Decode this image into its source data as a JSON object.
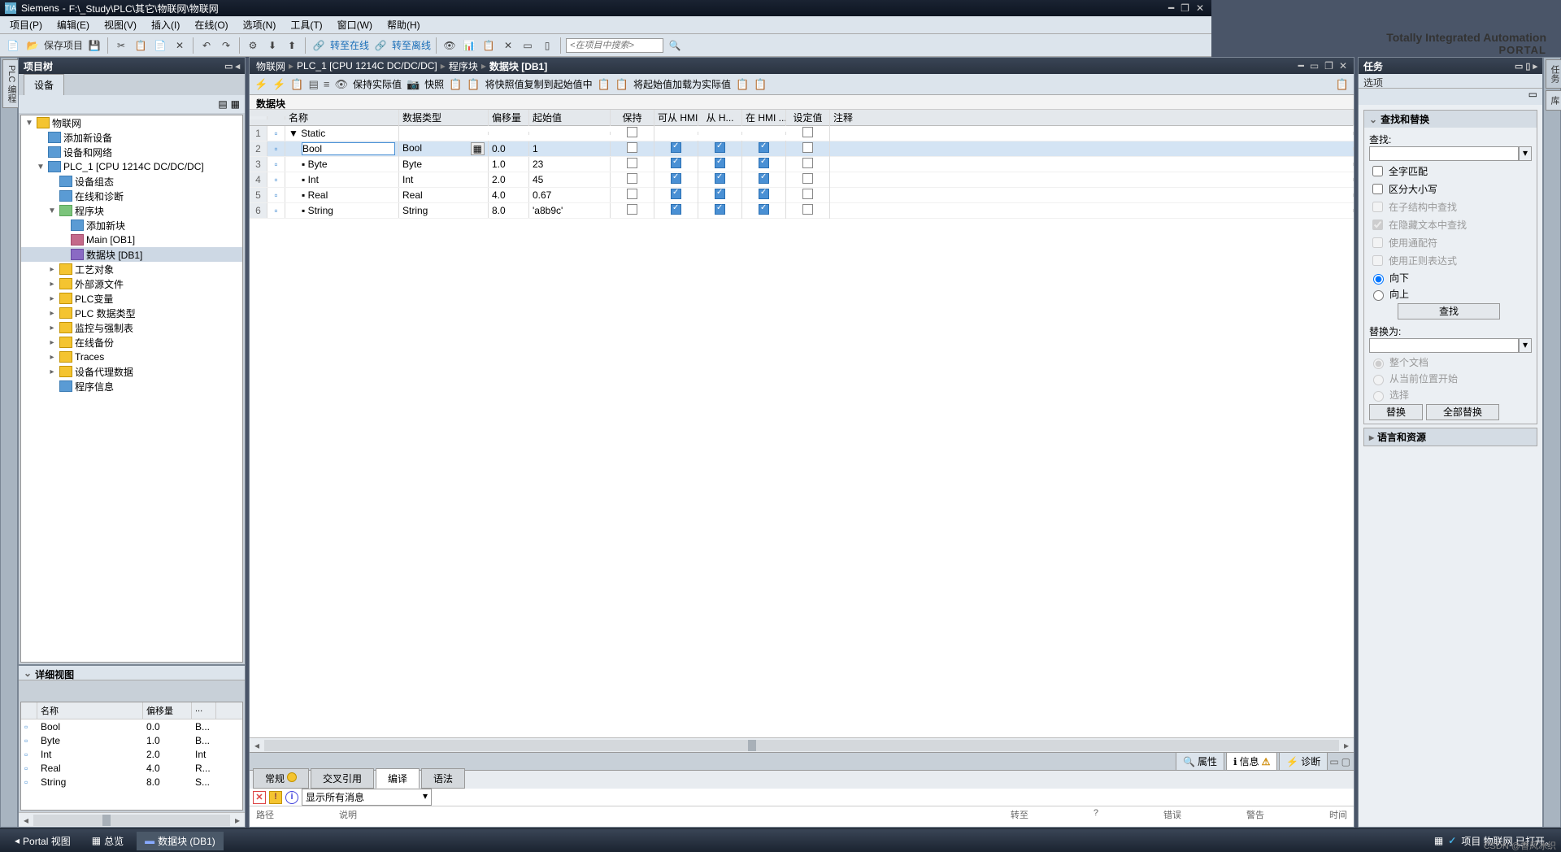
{
  "title": {
    "app": "Siemens",
    "path": "F:\\_Study\\PLC\\其它\\物联网\\物联网"
  },
  "menu": [
    "项目(P)",
    "编辑(E)",
    "视图(V)",
    "插入(I)",
    "在线(O)",
    "选项(N)",
    "工具(T)",
    "窗口(W)",
    "帮助(H)"
  ],
  "brand": {
    "t1": "Totally Integrated Automation",
    "t2": "PORTAL"
  },
  "toolbar": {
    "save": "保存项目",
    "goonline": "转至在线",
    "gooffline": "转至离线",
    "search_ph": "<在项目中搜索>"
  },
  "left_panel": {
    "title": "项目树",
    "tab": "设备"
  },
  "tree": [
    {
      "d": 0,
      "exp": "▼",
      "ic": "ic-folder",
      "t": "物联网"
    },
    {
      "d": 1,
      "exp": "",
      "ic": "ic-device",
      "t": "添加新设备"
    },
    {
      "d": 1,
      "exp": "",
      "ic": "ic-device",
      "t": "设备和网络"
    },
    {
      "d": 1,
      "exp": "▼",
      "ic": "ic-device",
      "t": "PLC_1 [CPU 1214C DC/DC/DC]"
    },
    {
      "d": 2,
      "exp": "",
      "ic": "ic-device",
      "t": "设备组态"
    },
    {
      "d": 2,
      "exp": "",
      "ic": "ic-device",
      "t": "在线和诊断"
    },
    {
      "d": 2,
      "exp": "▼",
      "ic": "ic-prog",
      "t": "程序块"
    },
    {
      "d": 3,
      "exp": "",
      "ic": "ic-device",
      "t": "添加新块"
    },
    {
      "d": 3,
      "exp": "",
      "ic": "ic-main",
      "t": "Main [OB1]"
    },
    {
      "d": 3,
      "exp": "",
      "ic": "ic-db",
      "t": "数据块 [DB1]",
      "sel": true
    },
    {
      "d": 2,
      "exp": "▸",
      "ic": "ic-folder",
      "t": "工艺对象"
    },
    {
      "d": 2,
      "exp": "▸",
      "ic": "ic-folder",
      "t": "外部源文件"
    },
    {
      "d": 2,
      "exp": "▸",
      "ic": "ic-folder",
      "t": "PLC变量"
    },
    {
      "d": 2,
      "exp": "▸",
      "ic": "ic-folder",
      "t": "PLC 数据类型"
    },
    {
      "d": 2,
      "exp": "▸",
      "ic": "ic-folder",
      "t": "监控与强制表"
    },
    {
      "d": 2,
      "exp": "▸",
      "ic": "ic-folder",
      "t": "在线备份"
    },
    {
      "d": 2,
      "exp": "▸",
      "ic": "ic-folder",
      "t": "Traces"
    },
    {
      "d": 2,
      "exp": "▸",
      "ic": "ic-folder",
      "t": "设备代理数据"
    },
    {
      "d": 2,
      "exp": "",
      "ic": "ic-device",
      "t": "程序信息"
    }
  ],
  "detail": {
    "title": "详细视图",
    "cols": [
      "名称",
      "偏移量",
      "..."
    ],
    "rows": [
      {
        "n": "Bool",
        "o": "0.0",
        "t": "B..."
      },
      {
        "n": "Byte",
        "o": "1.0",
        "t": "B..."
      },
      {
        "n": "Int",
        "o": "2.0",
        "t": "Int"
      },
      {
        "n": "Real",
        "o": "4.0",
        "t": "R..."
      },
      {
        "n": "String",
        "o": "8.0",
        "t": "S..."
      }
    ]
  },
  "crumb": [
    "物联网",
    "PLC_1 [CPU 1214C DC/DC/DC]",
    "程序块",
    "数据块 [DB1]"
  ],
  "ctoolbar": {
    "keep": "保持实际值",
    "snap": "快照",
    "copy_snap": "将快照值复制到起始值中",
    "load_init": "将起始值加载为实际值"
  },
  "ctitle": "数据块",
  "grid": {
    "cols": [
      "",
      "",
      "名称",
      "数据类型",
      "偏移量",
      "起始值",
      "保持",
      "可从 HMI/...",
      "从 H...",
      "在 HMI ...",
      "设定值",
      "注释"
    ],
    "rows": [
      {
        "n": 1,
        "name": "Static",
        "type": "",
        "off": "",
        "init": "",
        "hdr": true
      },
      {
        "n": 2,
        "name": "Bool",
        "type": "Bool",
        "off": "0.0",
        "init": "1",
        "chk": [
          false,
          true,
          true,
          true,
          false
        ],
        "sel": true
      },
      {
        "n": 3,
        "name": "Byte",
        "type": "Byte",
        "off": "1.0",
        "init": "23",
        "chk": [
          false,
          true,
          true,
          true,
          false
        ]
      },
      {
        "n": 4,
        "name": "Int",
        "type": "Int",
        "off": "2.0",
        "init": "45",
        "chk": [
          false,
          true,
          true,
          true,
          false
        ]
      },
      {
        "n": 5,
        "name": "Real",
        "type": "Real",
        "off": "4.0",
        "init": "0.67",
        "chk": [
          false,
          true,
          true,
          true,
          false
        ]
      },
      {
        "n": 6,
        "name": "String",
        "type": "String",
        "off": "8.0",
        "init": "'a8b9c'",
        "chk": [
          false,
          true,
          true,
          true,
          false
        ]
      }
    ]
  },
  "btabs": [
    {
      "l": "属性",
      "ic": "🔍"
    },
    {
      "l": "信息",
      "ic": "ℹ",
      "act": true
    },
    {
      "l": "诊断",
      "ic": "⚡"
    }
  ],
  "itabs": [
    "常规",
    "交叉引用",
    "编译",
    "语法"
  ],
  "itab_active": 2,
  "msg_filter": "显示所有消息",
  "msg_cols": [
    "路径",
    "说明",
    "转至",
    "?",
    "错误",
    "警告",
    "时间"
  ],
  "right": {
    "title": "任务",
    "opt": "选项",
    "find": {
      "h": "查找和替换",
      "lbl": "查找:",
      "whole": "全字匹配",
      "case": "区分大小写",
      "instruct": "在子结构中查找",
      "inhidden": "在隐藏文本中查找",
      "wildcard": "使用通配符",
      "regex": "使用正则表达式",
      "down": "向下",
      "up": "向上",
      "btn": "查找"
    },
    "replace": {
      "lbl": "替换为:",
      "whole_doc": "整个文档",
      "from_cur": "从当前位置开始",
      "sel": "选择",
      "btn": "替换",
      "btn_all": "全部替换"
    },
    "lang": "语言和资源"
  },
  "appbar": {
    "portal": "Portal 视图",
    "overview": "总览",
    "db": "数据块 (DB1)",
    "status": "项目 物联网 已打开。"
  },
  "rail": {
    "left": "PLC 编程",
    "r1": "任务",
    "r2": "库"
  },
  "watermark": "CSDN @香风冰织"
}
